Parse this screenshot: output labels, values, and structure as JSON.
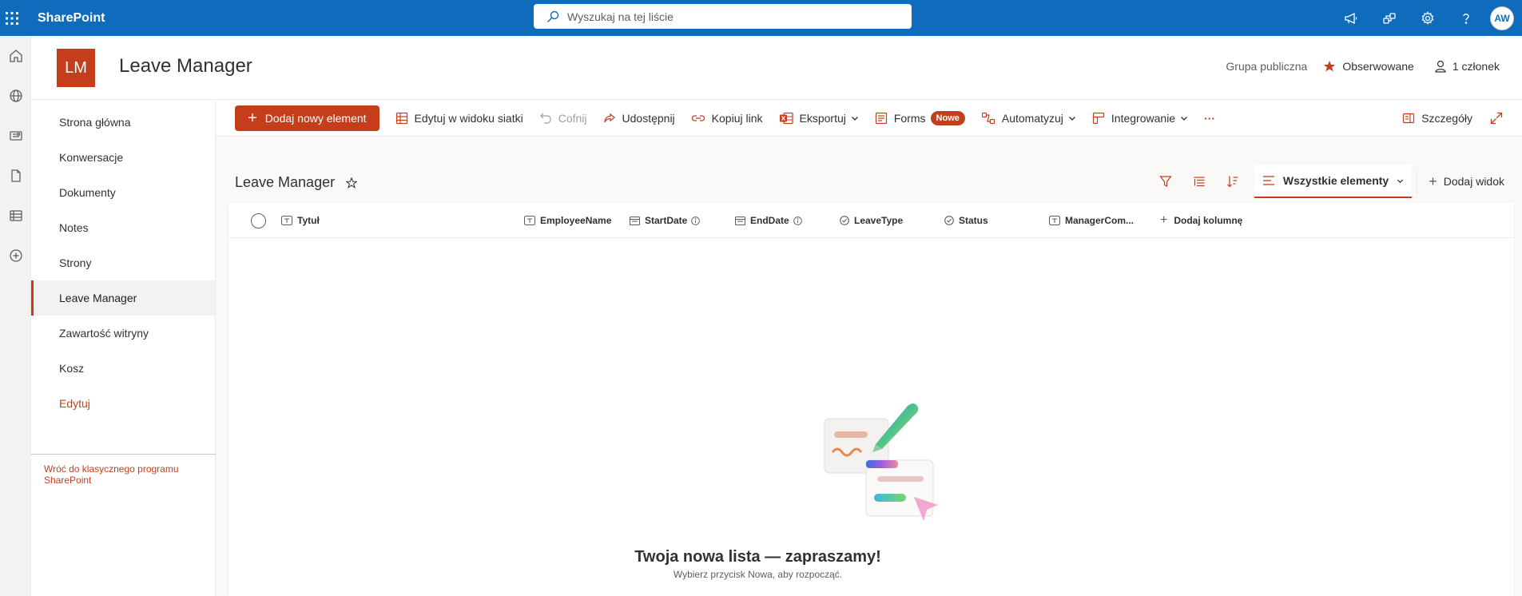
{
  "suitebar": {
    "app_name": "SharePoint",
    "search_placeholder": "Wyszukaj na tej liście",
    "avatar_initials": "AW",
    "bg_color": "#0f6cbd"
  },
  "site": {
    "logo_initials": "LM",
    "title": "Leave Manager",
    "group_type": "Grupa publiczna",
    "follow_label": "Obserwowane",
    "members_label": "1 członek",
    "accent_color": "#c43e1c"
  },
  "nav": {
    "items": [
      {
        "label": "Strona główna"
      },
      {
        "label": "Konwersacje"
      },
      {
        "label": "Dokumenty"
      },
      {
        "label": "Notes"
      },
      {
        "label": "Strony"
      },
      {
        "label": "Leave Manager"
      },
      {
        "label": "Zawartość witryny"
      },
      {
        "label": "Kosz"
      }
    ],
    "active_index": 5,
    "edit_label": "Edytuj",
    "classic_link": "Wróć do klasycznego programu SharePoint"
  },
  "commands": {
    "new_item": "Dodaj nowy element",
    "grid_edit": "Edytuj w widoku siatki",
    "undo": "Cofnij",
    "share": "Udostępnij",
    "copy_link": "Kopiuj link",
    "export": "Eksportuj",
    "forms": "Forms",
    "forms_badge": "Nowe",
    "automate": "Automatyzuj",
    "integrate": "Integrowanie",
    "more": "···",
    "details": "Szczegóły"
  },
  "list": {
    "title": "Leave Manager",
    "view_name": "Wszystkie elementy",
    "add_view": "Dodaj widok",
    "columns": {
      "title": "Tytuł",
      "employee": "EmployeeName",
      "start": "StartDate",
      "end": "EndDate",
      "leave_type": "LeaveType",
      "status": "Status",
      "manager": "ManagerCom...",
      "add_column": "Dodaj kolumnę"
    },
    "empty_title": "Twoja nowa lista — zapraszamy!",
    "empty_subtitle": "Wybierz przycisk Nowa, aby rozpocząć."
  }
}
